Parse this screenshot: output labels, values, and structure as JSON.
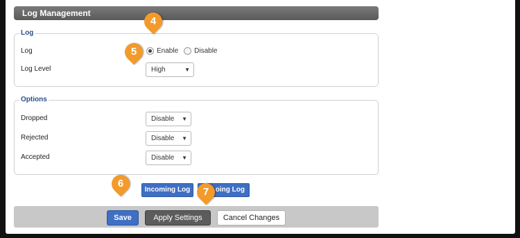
{
  "page_title": "Log Management",
  "log_section": {
    "legend": "Log",
    "log_label": "Log",
    "radio_enable": "Enable",
    "radio_disable": "Disable",
    "selected": "Enable",
    "level_label": "Log Level",
    "level_value": "High"
  },
  "options_section": {
    "legend": "Options",
    "rows": [
      {
        "label": "Dropped",
        "value": "Disable"
      },
      {
        "label": "Rejected",
        "value": "Disable"
      },
      {
        "label": "Accepted",
        "value": "Disable"
      }
    ]
  },
  "log_buttons": {
    "incoming": "Incoming Log",
    "outgoing_visible": "oing Log"
  },
  "footer": {
    "save": "Save",
    "apply": "Apply Settings",
    "cancel": "Cancel Changes"
  },
  "markers": [
    "4",
    "5",
    "6",
    "7"
  ],
  "caret_glyph": "▼",
  "colors": {
    "accent": "#3f6fc4",
    "marker": "#f39a2b",
    "title_bar": "#6a6a6a"
  }
}
